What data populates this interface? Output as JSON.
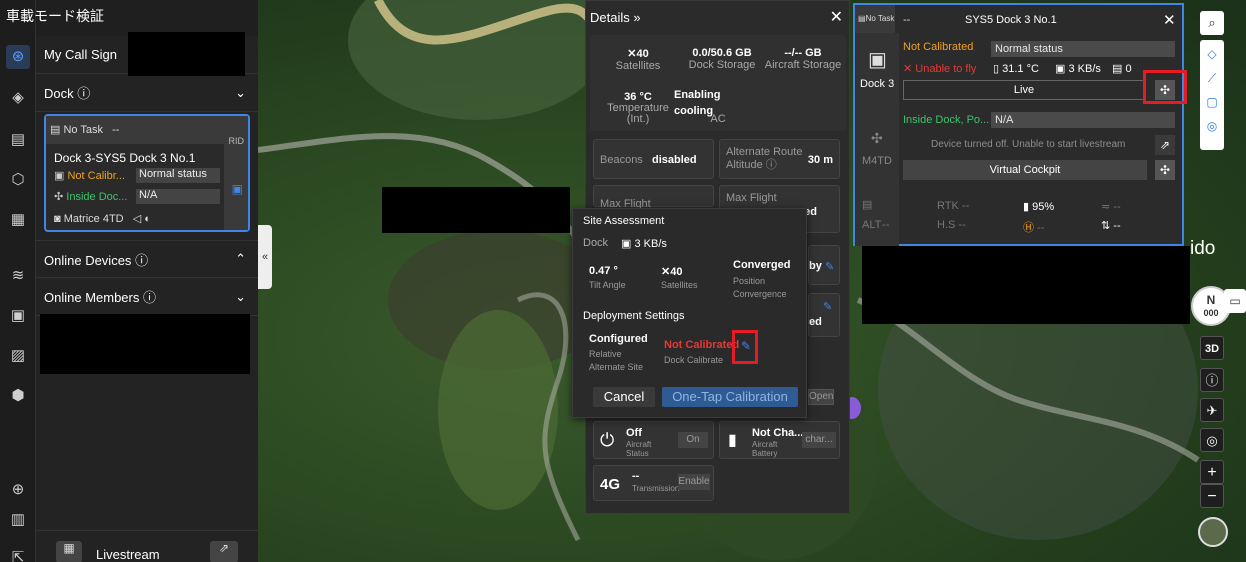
{
  "app": {
    "title": "車載モード検証"
  },
  "left_panel": {
    "call_sign_label": "My Call Sign",
    "dock_section": "Dock",
    "online_devices": "Online Devices",
    "online_members": "Online Members",
    "livestream": "Livestream",
    "card": {
      "task_badge": "No Task",
      "task_value": "--",
      "rid": "RID",
      "dock_name": "Dock 3-SYS5 Dock 3 No.1",
      "calib": "Not Calibr...",
      "status": "Normal status",
      "location": "Inside Doc...",
      "location_value": "N/A",
      "aircraft": "Matrice 4TD"
    }
  },
  "details": {
    "title": "Details",
    "satellites_value": "40",
    "satellites_label": "Satellites",
    "dock_storage_value": "0.0/50.6 GB",
    "dock_storage_label": "Dock Storage",
    "aircraft_storage_value": "--/-- GB",
    "aircraft_storage_label": "Aircraft Storage",
    "temp_value": "36 °C",
    "temp_label": "Temperature (Int.)",
    "ac_value": "Enabling cooling",
    "ac_label": "AC",
    "beacons_label": "Beacons",
    "beacons_value": "disabled",
    "alt_route_label": "Alternate Route Altitude",
    "alt_route_value": "30 m",
    "max_flight_1": "Max Flight",
    "max_flight_2": "Max Flight",
    "partial_1": "ed",
    "partial_2": "by",
    "partial_3": "ed",
    "open_btn": "Open",
    "aircraft_status_value": "Off",
    "aircraft_status_label": "Aircraft Status",
    "on_btn": "On",
    "battery_value": "Not Cha...",
    "battery_label": "Aircraft Battery",
    "charge_btn": "char...",
    "transmission_value": "--",
    "transmission_label": "Transmission",
    "net_label": "4G",
    "enable_btn": "Enable"
  },
  "site": {
    "title": "Site Assessment",
    "dock": "Dock",
    "rate": "3 KB/s",
    "tilt_value": "0.47 °",
    "tilt_label": "Tilt Angle",
    "sat_value": "40",
    "sat_label": "Satellites",
    "conv_value": "Converged",
    "conv_label": "Position Convergence",
    "deploy_title": "Deployment Settings",
    "configured": "Configured",
    "alt_site": "Relative Alternate Site",
    "not_calib": "Not Calibrated",
    "dock_calib": "Dock Calibrate",
    "cancel": "Cancel",
    "one_tap": "One-Tap Calibration"
  },
  "dock_panel": {
    "badge": "No Task",
    "task": "--",
    "title": "SYS5 Dock 3 No.1",
    "dock_label": "Dock 3",
    "not_calibrated": "Not Calibrated",
    "normal_status": "Normal status",
    "unable": "Unable to fly",
    "temp": "31.1 °C",
    "rate": "3 KB/s",
    "count": "0",
    "live": "Live",
    "inside": "Inside Dock, Po...",
    "na": "N/A",
    "turned_off": "Device turned off. Unable to start livestream",
    "aircraft_label": "M4TD",
    "virtual_cockpit": "Virtual Cockpit",
    "rtk": "RTK",
    "rtk_v": "--",
    "battery": "95%",
    "alt": "ALT",
    "alt_v": "--",
    "hs": "H.S",
    "hs_v": "--",
    "h_v": "--",
    "sig_v": "--",
    "updown_v": "--",
    "right_dash": "--"
  },
  "map": {
    "place_text": "ido",
    "compass": "N",
    "compass_deg": "000",
    "view_3d": "3D"
  },
  "colors": {
    "accent": "#3f86e6",
    "warn": "#f0a020",
    "danger": "#e53935",
    "ok": "#3cc36a",
    "highlight": "#e51c23"
  }
}
